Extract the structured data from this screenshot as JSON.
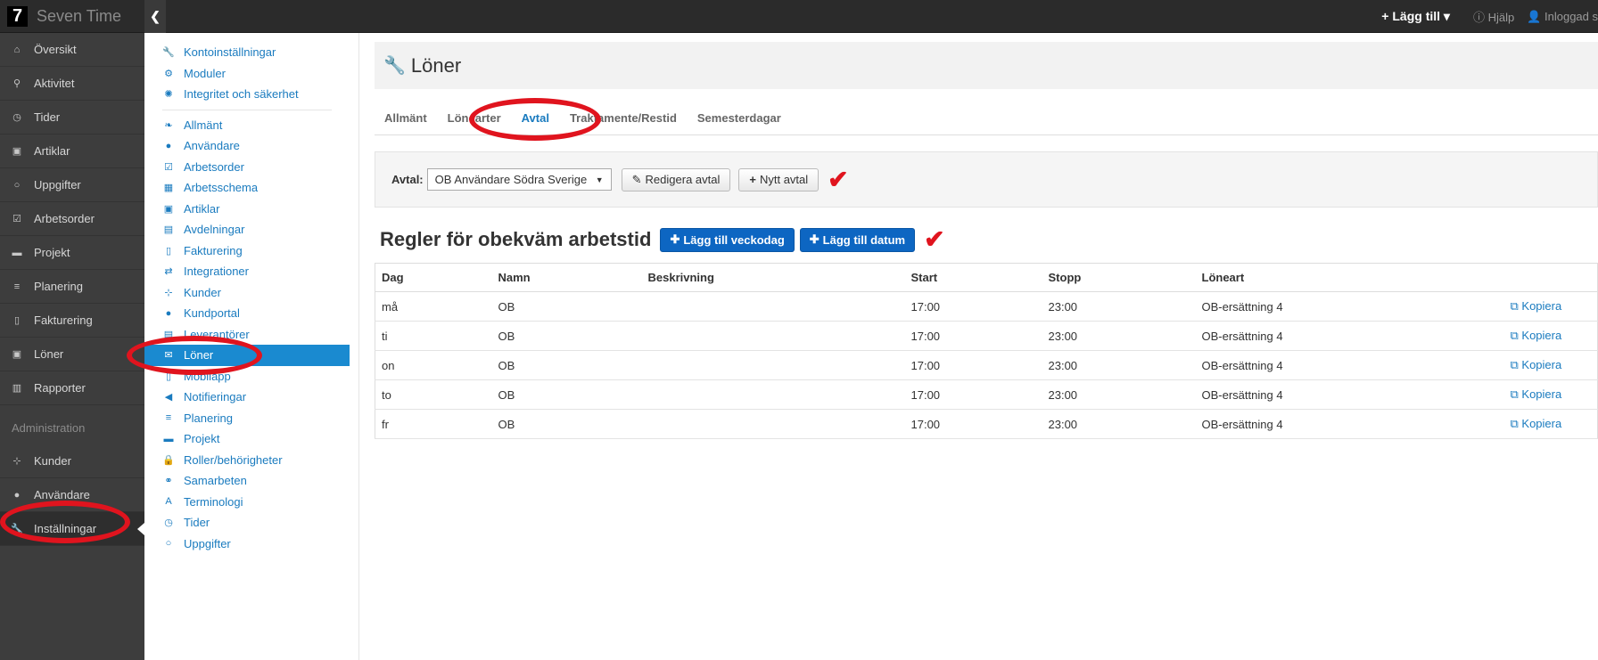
{
  "app": {
    "logo": "7",
    "name": "Seven Time"
  },
  "topbar": {
    "add_label": "+ Lägg till ▾",
    "help": "ⓘ Hjälp",
    "user": "👤 Inloggad s"
  },
  "sidebar": {
    "items": [
      {
        "label": "Översikt",
        "icon": "⌂"
      },
      {
        "label": "Aktivitet",
        "icon": "⚲"
      },
      {
        "label": "Tider",
        "icon": "◷"
      },
      {
        "label": "Artiklar",
        "icon": "▣"
      },
      {
        "label": "Uppgifter",
        "icon": "○"
      },
      {
        "label": "Arbetsorder",
        "icon": "☑"
      },
      {
        "label": "Projekt",
        "icon": "▬"
      },
      {
        "label": "Planering",
        "icon": "≡"
      },
      {
        "label": "Fakturering",
        "icon": "▯"
      },
      {
        "label": "Löner",
        "icon": "▣"
      },
      {
        "label": "Rapporter",
        "icon": "▥"
      }
    ],
    "section": "Administration",
    "admin_items": [
      {
        "label": "Kunder",
        "icon": "⊹"
      },
      {
        "label": "Användare",
        "icon": "●"
      },
      {
        "label": "Inställningar",
        "icon": "🔧"
      }
    ]
  },
  "settings_nav": {
    "top": [
      {
        "label": "Kontoinställningar",
        "icon": "🔧"
      },
      {
        "label": "Moduler",
        "icon": "⚙"
      },
      {
        "label": "Integritet och säkerhet",
        "icon": "✺"
      }
    ],
    "items": [
      {
        "label": "Allmänt",
        "icon": "❧"
      },
      {
        "label": "Användare",
        "icon": "●"
      },
      {
        "label": "Arbetsorder",
        "icon": "☑"
      },
      {
        "label": "Arbetsschema",
        "icon": "▦"
      },
      {
        "label": "Artiklar",
        "icon": "▣"
      },
      {
        "label": "Avdelningar",
        "icon": "▤"
      },
      {
        "label": "Fakturering",
        "icon": "▯"
      },
      {
        "label": "Integrationer",
        "icon": "⇄"
      },
      {
        "label": "Kunder",
        "icon": "⊹"
      },
      {
        "label": "Kundportal",
        "icon": "●"
      },
      {
        "label": "Leverantörer",
        "icon": "▤"
      },
      {
        "label": "Löner",
        "icon": "✉"
      },
      {
        "label": "Mobilapp",
        "icon": "▯"
      },
      {
        "label": "Notifieringar",
        "icon": "◀"
      },
      {
        "label": "Planering",
        "icon": "≡"
      },
      {
        "label": "Projekt",
        "icon": "▬"
      },
      {
        "label": "Roller/behörigheter",
        "icon": "🔒"
      },
      {
        "label": "Samarbeten",
        "icon": "⚭"
      },
      {
        "label": "Terminologi",
        "icon": "A"
      },
      {
        "label": "Tider",
        "icon": "◷"
      },
      {
        "label": "Uppgifter",
        "icon": "○"
      }
    ]
  },
  "page": {
    "title": "Löner",
    "tabs": [
      "Allmänt",
      "Lönearter",
      "Avtal",
      "Traktamente/Restid",
      "Semesterdagar"
    ],
    "filter": {
      "label": "Avtal:",
      "selected": "OB Användare Södra Sverige",
      "edit_button": "Redigera avtal",
      "new_button": "Nytt avtal"
    },
    "rules_title": "Regler för obekväm arbetstid",
    "add_weekday": "Lägg till veckodag",
    "add_date": "Lägg till datum",
    "table": {
      "headers": [
        "Dag",
        "Namn",
        "Beskrivning",
        "Start",
        "Stopp",
        "Löneart"
      ],
      "copy_label": "Kopiera",
      "rows": [
        {
          "day": "må",
          "name": "OB",
          "desc": "",
          "start": "17:00",
          "stop": "23:00",
          "type": "OB-ersättning 4"
        },
        {
          "day": "ti",
          "name": "OB",
          "desc": "",
          "start": "17:00",
          "stop": "23:00",
          "type": "OB-ersättning 4"
        },
        {
          "day": "on",
          "name": "OB",
          "desc": "",
          "start": "17:00",
          "stop": "23:00",
          "type": "OB-ersättning 4"
        },
        {
          "day": "to",
          "name": "OB",
          "desc": "",
          "start": "17:00",
          "stop": "23:00",
          "type": "OB-ersättning 4"
        },
        {
          "day": "fr",
          "name": "OB",
          "desc": "",
          "start": "17:00",
          "stop": "23:00",
          "type": "OB-ersättning 4"
        }
      ]
    }
  },
  "colors": {
    "accent": "#1a7bbf",
    "primary_button": "#0d66c2",
    "annotation": "#e0141e",
    "sidebar_bg": "#3d3d3d"
  }
}
